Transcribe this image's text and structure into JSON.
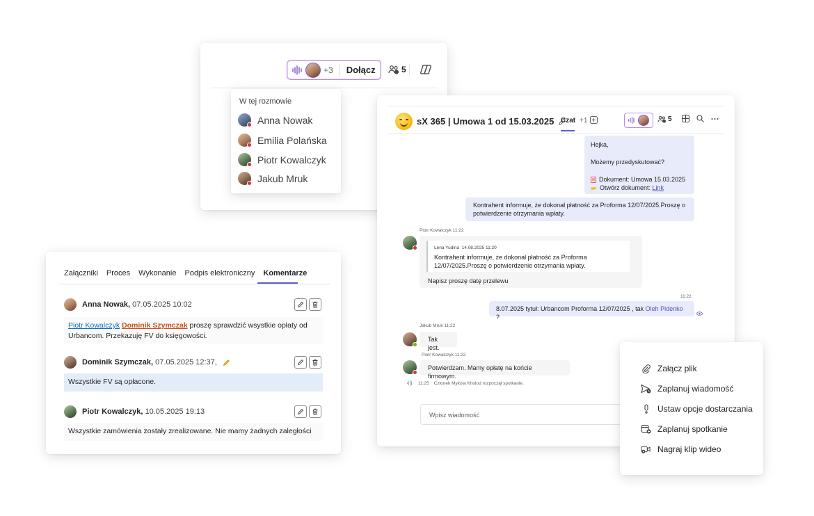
{
  "call_card": {
    "more_count": "+3",
    "join_label": "Dołącz",
    "people_count": "5"
  },
  "participants": {
    "heading": "W tej rozmowie",
    "names": [
      "Anna Nowak",
      "Emilia Polańska",
      "Piotr Kowalczyk",
      "Jakub Mruk"
    ]
  },
  "chat": {
    "title": "sX 365 | Umowa 1 od 15.03.2025",
    "tab_label": "Czat",
    "tab_more": "+1",
    "people_count": "5",
    "msg1": {
      "line1": "Hejka,",
      "line2": "Możemy przedyskutować?",
      "line3_prefix": "Dokument: Umowa 15.03.2025",
      "line4_prefix": "Otwórz dokument: ",
      "line4_link": "Link"
    },
    "msg2": "Kontrahent informuje, że dokonał płatność za Proforma 12/07/2025.Proszę o potwierdzenie otrzymania wpłaty.",
    "msg3": {
      "meta": "Piotr Kowalczyk 11:22",
      "quote_author": "Lena Yudina",
      "quote_time": "14.08.2025 11:20",
      "quote_text": "Kontrahent informuje, że dokonał płatność za Proforma 12/07/2025.Proszę o potwierdzenie otrzymania wpłaty.",
      "text": "Napisz proszę datę przelewu"
    },
    "msg4": {
      "time": "11:22",
      "text_prefix": "8.07.2025 tytuł: Urbancom Proforma 12/07/2025 , tak ",
      "mention": "Oleh Pidenko",
      "text_suffix": " ?"
    },
    "msg5": {
      "meta": "Jakub Mruk 11:22",
      "text": "Tak jest."
    },
    "msg6": {
      "meta": "Piotr Kowalczyk 11:22",
      "text": "Potwierdzam. Mamy opłatę na końcie firmowym."
    },
    "event": {
      "time": "11:25",
      "text": "Członek Mykola Kholod rozpoczął spotkanie."
    },
    "compose_placeholder": "Wpisz wiadomość"
  },
  "comments": {
    "tabs": [
      "Załączniki",
      "Proces",
      "Wykonanie",
      "Podpis elektroniczny",
      "Komentarze"
    ],
    "items": [
      {
        "author": "Anna Nowak,",
        "time": "07.05.2025 10:02",
        "mention1": "Piotr Kowalczyk",
        "mention2": "Dominik Szymczak",
        "text": " proszę sprawdzić wsystkie opłaty od Urbancom. Przekazuję FV do księgowości."
      },
      {
        "author": "Dominik Szymczak,",
        "time": "07.05.2025 12:37,",
        "text": "Wszystkie FV są opłacone."
      },
      {
        "author": "Piotr Kowalczyk,",
        "time": "10.05.2025 19:13",
        "text": "Wszystkie zamówienia zostały zrealizowane. Nie mamy żadnych zaległości"
      }
    ]
  },
  "menu": {
    "items": [
      "Załącz plik",
      "Zaplanuj wiadomość",
      "Ustaw opcje dostarczania",
      "Zaplanuj spotkanie",
      "Nagraj klip wideo"
    ]
  },
  "colors": {
    "accent": "#5b5fc7",
    "bubble_me": "#e8ebfa",
    "highlight_comment": "#e3edf9",
    "busy": "#d13438",
    "available": "#6bb700"
  }
}
